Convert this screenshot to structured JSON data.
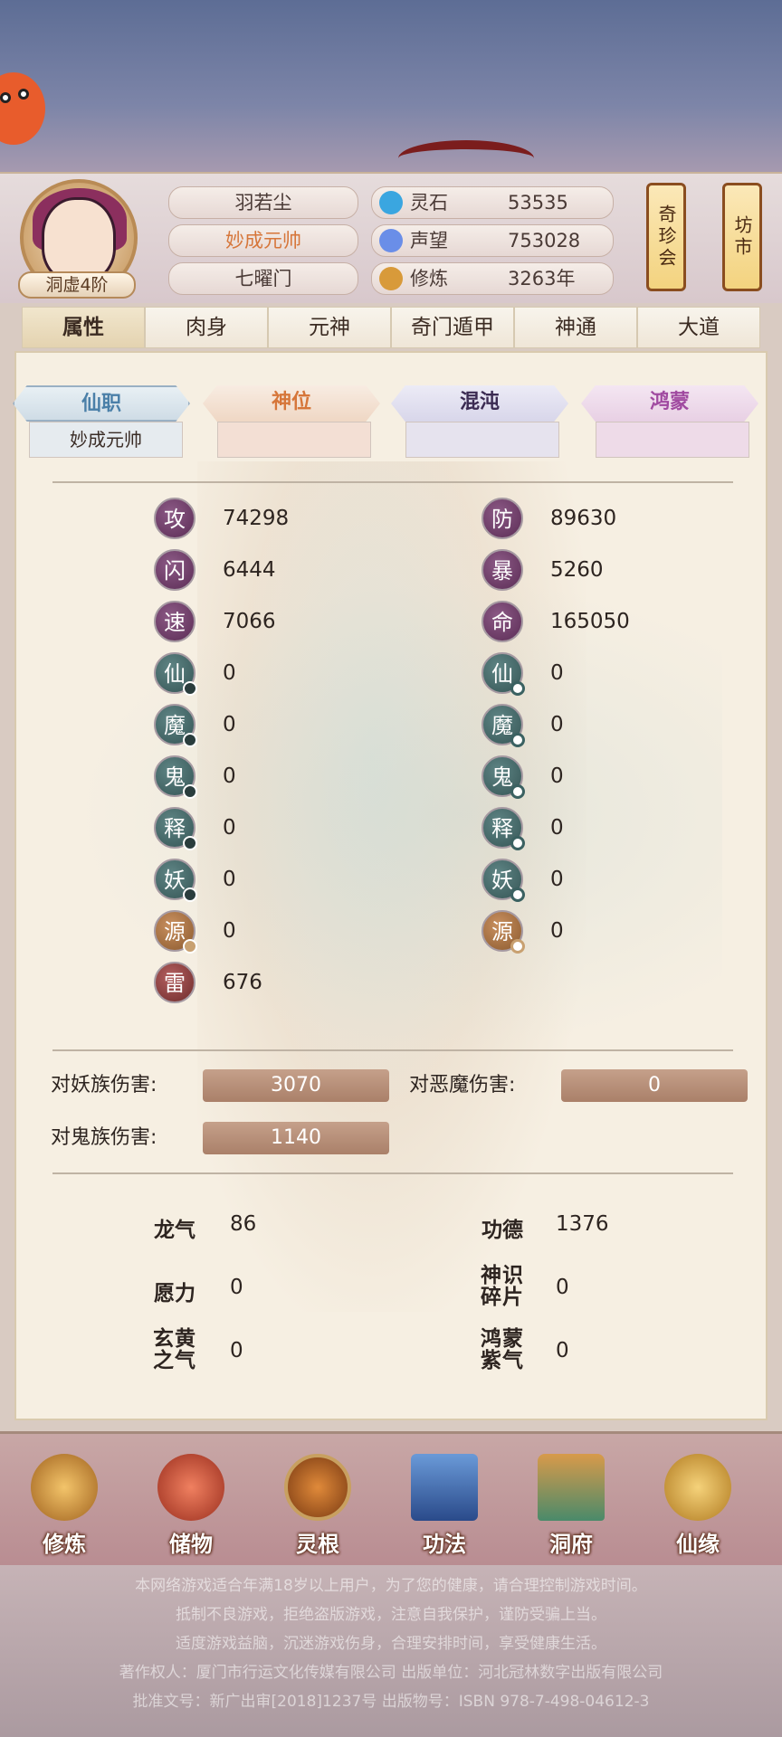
{
  "player": {
    "realm": "洞虚4阶",
    "name": "羽若尘",
    "title": "妙成元帅",
    "sect": "七曜门"
  },
  "resources": [
    {
      "label": "灵石",
      "value": "53535",
      "icon": "spirit-stone-icon",
      "color": "#3aa6e0"
    },
    {
      "label": "声望",
      "value": "753028",
      "icon": "prestige-icon",
      "color": "#6a8ee8"
    },
    {
      "label": "修炼",
      "value": "3263年",
      "icon": "meditation-icon",
      "color": "#d89a3a"
    }
  ],
  "side_buttons": [
    "奇珍会",
    "坊市"
  ],
  "tabs": [
    "属性",
    "肉身",
    "元神",
    "奇门遁甲",
    "神通",
    "大道"
  ],
  "active_tab": "属性",
  "ranks": [
    {
      "label": "仙职",
      "value": "妙成元帅",
      "color": "#4a7fa8"
    },
    {
      "label": "神位",
      "value": "",
      "color": "#d6763a"
    },
    {
      "label": "混沌",
      "value": "",
      "color": "#6a5aa0"
    },
    {
      "label": "鸿蒙",
      "value": "",
      "color": "#a04aa0"
    }
  ],
  "stats_left": [
    {
      "glyph": "攻",
      "value": "74298"
    },
    {
      "glyph": "闪",
      "value": "6444"
    },
    {
      "glyph": "速",
      "value": "7066"
    },
    {
      "glyph": "仙",
      "value": "0"
    },
    {
      "glyph": "魔",
      "value": "0"
    },
    {
      "glyph": "鬼",
      "value": "0"
    },
    {
      "glyph": "释",
      "value": "0"
    },
    {
      "glyph": "妖",
      "value": "0"
    },
    {
      "glyph": "源",
      "value": "0"
    },
    {
      "glyph": "雷",
      "value": "676"
    }
  ],
  "stats_right": [
    {
      "glyph": "防",
      "value": "89630"
    },
    {
      "glyph": "暴",
      "value": "5260"
    },
    {
      "glyph": "命",
      "value": "165050"
    },
    {
      "glyph": "仙",
      "value": "0"
    },
    {
      "glyph": "魔",
      "value": "0"
    },
    {
      "glyph": "鬼",
      "value": "0"
    },
    {
      "glyph": "释",
      "value": "0"
    },
    {
      "glyph": "妖",
      "value": "0"
    },
    {
      "glyph": "源",
      "value": "0"
    }
  ],
  "damage": [
    {
      "label": "对妖族伤害:",
      "value": "3070"
    },
    {
      "label": "对恶魔伤害:",
      "value": "0"
    },
    {
      "label": "对鬼族伤害:",
      "value": "1140"
    }
  ],
  "misc": [
    {
      "label": "龙气",
      "value": "86"
    },
    {
      "label": "功德",
      "value": "1376"
    },
    {
      "label": "愿力",
      "value": "0"
    },
    {
      "label": "神识碎片",
      "value": "0"
    },
    {
      "label": "玄黄之气",
      "value": "0"
    },
    {
      "label": "鸿蒙紫气",
      "value": "0"
    }
  ],
  "bottom_nav": [
    {
      "label": "修炼",
      "icon": "cultivate-icon",
      "color": "#d89a3a"
    },
    {
      "label": "储物",
      "icon": "storage-bag-icon",
      "color": "#c8503a"
    },
    {
      "label": "灵根",
      "icon": "spirit-root-icon",
      "color": "#b8642a"
    },
    {
      "label": "功法",
      "icon": "technique-book-icon",
      "color": "#4a78b8"
    },
    {
      "label": "洞府",
      "icon": "cave-mansion-icon",
      "color": "#3a8a6a"
    },
    {
      "label": "仙缘",
      "icon": "gourd-icon",
      "color": "#d8a040"
    }
  ],
  "footer": [
    "本网络游戏适合年满18岁以上用户，为了您的健康，请合理控制游戏时间。",
    "抵制不良游戏，拒绝盗版游戏，注意自我保护，谨防受骗上当。",
    "适度游戏益脑，沉迷游戏伤身，合理安排时间，享受健康生活。",
    "著作权人：厦门市行运文化传媒有限公司  出版单位：河北冠林数字出版有限公司",
    "批准文号：新广出审[2018]1237号 出版物号：ISBN 978-7-498-04612-3"
  ]
}
